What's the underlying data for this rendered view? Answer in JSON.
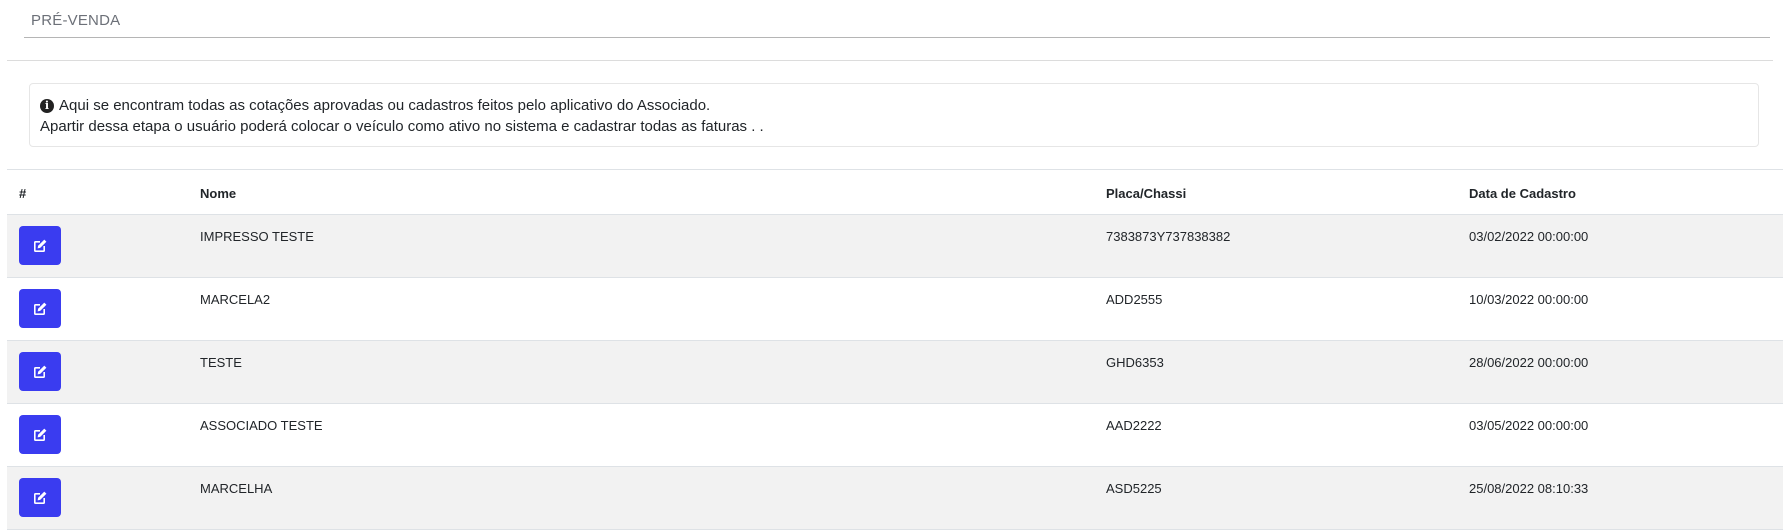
{
  "header": {
    "title": "PRÉ-VENDA"
  },
  "info": {
    "icon": "info-circle-icon",
    "line1": "Aqui se encontram todas as cotações aprovadas ou cadastros feitos pelo aplicativo do Associado.",
    "line2": "Apartir dessa etapa o usuário poderá colocar o veículo como ativo no sistema e cadastrar todas as faturas . ."
  },
  "table": {
    "columns": [
      "#",
      "Nome",
      "Placa/Chassi",
      "Data de Cadastro"
    ],
    "rows": [
      {
        "nome": "IMPRESSO TESTE",
        "placa": "7383873Y737838382",
        "data": "03/02/2022 00:00:00"
      },
      {
        "nome": "MARCELA2",
        "placa": "ADD2555",
        "data": "10/03/2022 00:00:00"
      },
      {
        "nome": "TESTE",
        "placa": "GHD6353",
        "data": "28/06/2022 00:00:00"
      },
      {
        "nome": "ASSOCIADO TESTE",
        "placa": "AAD2222",
        "data": "03/05/2022 00:00:00"
      },
      {
        "nome": "MARCELHA",
        "placa": "ASD5225",
        "data": "25/08/2022 08:10:33"
      }
    ],
    "row_action_icon": "edit-icon"
  },
  "colors": {
    "primary_button": "#3a3cf0",
    "stripe": "#f2f2f2"
  }
}
